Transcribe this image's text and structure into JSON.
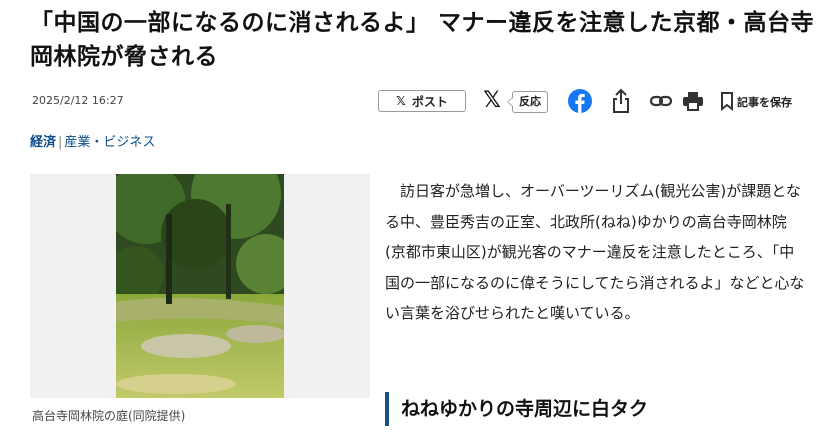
{
  "article": {
    "headline": "「中国の一部になるのに消されるよ」 マナー違反を注意した京都・高台寺岡林院が脅される",
    "date": "2025/2/12 16:27",
    "category": {
      "main": "経済",
      "separator": "|",
      "sub": "産業・ビジネス"
    },
    "photo": {
      "caption": "高台寺岡林院の庭(同院提供)"
    },
    "body": "訪日客が急増し、オーバーツーリズム(観光公害)が課題となる中、豊臣秀吉の正室、北政所(ねね)ゆかりの高台寺岡林院(京都市東山区)が観光客のマナー違反を注意したところ、「中国の一部になるのに偉そうにしてたら消されるよ」などと心ない言葉を浴びせられたと嘆いている。",
    "subheading": "ねねゆかりの寺周辺に白タク"
  },
  "share_bar": {
    "post_x_glyph": "𝕏",
    "post_label": "ポスト",
    "x_glyph": "𝕏",
    "reaction_label": "反応",
    "save_label": "記事を保存"
  },
  "icons": {
    "x_post": "x-logo-icon",
    "x": "x-logo-icon",
    "facebook": "facebook-icon",
    "share": "share-icon",
    "link": "link-icon",
    "print": "print-icon",
    "bookmark": "bookmark-icon"
  },
  "colors": {
    "category_link": "#0d4f8b",
    "facebook": "#1877f2",
    "subhead_bar": "#174f8a"
  }
}
